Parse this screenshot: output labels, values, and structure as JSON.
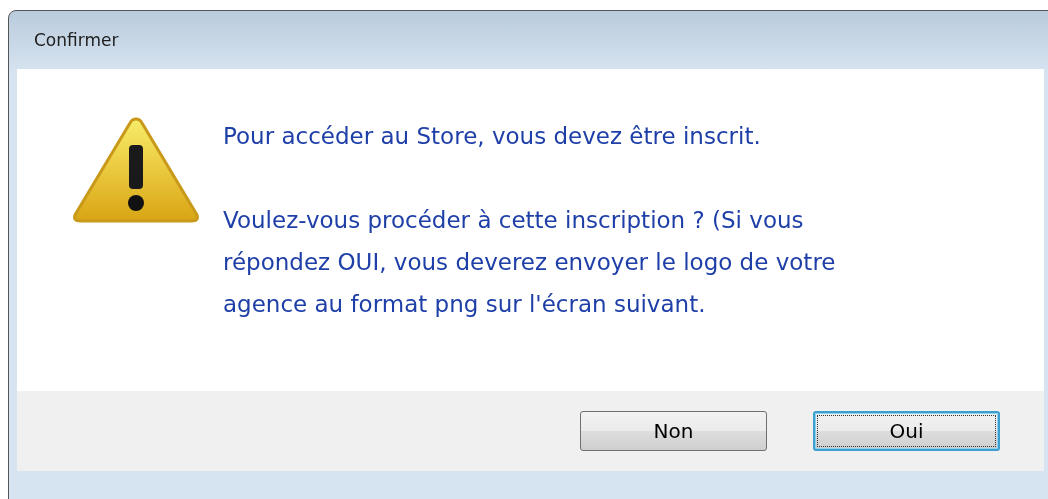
{
  "window": {
    "title": "Confirmer"
  },
  "message": {
    "paragraphs": [
      [
        "Pour accéder au Store, vous devez être inscrit."
      ],
      [
        "Voulez-vous procéder à cette inscription ? (Si vous",
        "répondez OUI, vous deverez envoyer le logo de votre",
        "agence au format png sur l'écran suivant."
      ]
    ]
  },
  "buttons": [
    {
      "label": "Non",
      "focused": false
    },
    {
      "label": "Oui",
      "focused": true
    }
  ]
}
